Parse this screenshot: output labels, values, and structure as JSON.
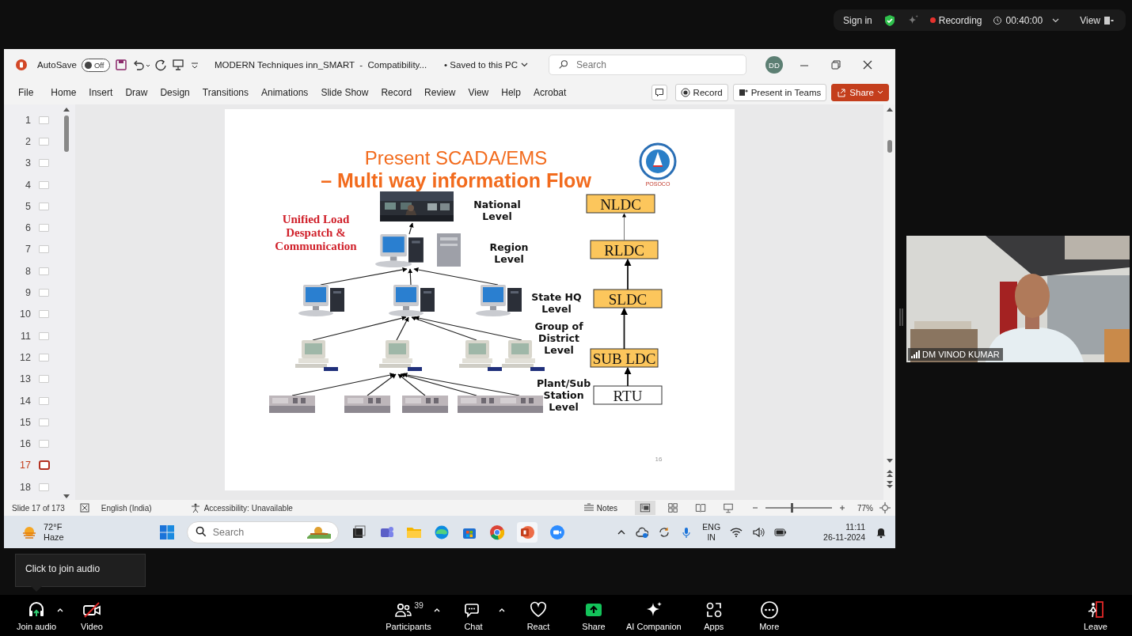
{
  "zoom_top_bar": {
    "sign_in": "Sign in",
    "recording": "Recording",
    "timer": "00:40:00",
    "view": "View"
  },
  "shared_screen": {
    "title_bar": {
      "autosave": "AutoSave",
      "autosave_on": false,
      "toggle_label": "Off",
      "document_title": "MODERN Techniques inn_SMART  -  Compatibility...",
      "save_status": "• Saved to this PC",
      "search_placeholder": "Search",
      "avatar": "DD"
    },
    "ribbon_tabs": [
      "File",
      "Home",
      "Insert",
      "Draw",
      "Design",
      "Transitions",
      "Animations",
      "Slide Show",
      "Record",
      "Review",
      "View",
      "Help",
      "Acrobat"
    ],
    "ribbon_buttons": [
      {
        "label": "Record",
        "kind": "record"
      },
      {
        "label": "Present in Teams",
        "kind": "teams"
      },
      {
        "label": "Share",
        "kind": "share"
      }
    ],
    "slide_thumbnails": [
      {
        "number": "1",
        "selected": false
      },
      {
        "number": "2",
        "selected": false
      },
      {
        "number": "3",
        "selected": false
      },
      {
        "number": "4",
        "selected": false
      },
      {
        "number": "5",
        "selected": false
      },
      {
        "number": "6",
        "selected": false
      },
      {
        "number": "7",
        "selected": false
      },
      {
        "number": "8",
        "selected": false
      },
      {
        "number": "9",
        "selected": false
      },
      {
        "number": "10",
        "selected": false
      },
      {
        "number": "11",
        "selected": false
      },
      {
        "number": "12",
        "selected": false
      },
      {
        "number": "13",
        "selected": false
      },
      {
        "number": "14",
        "selected": false
      },
      {
        "number": "15",
        "selected": false
      },
      {
        "number": "16",
        "selected": false
      },
      {
        "number": "17",
        "selected": true
      },
      {
        "number": "18",
        "selected": false
      }
    ],
    "slide": {
      "title_lines": [
        "Present SCADA/EMS",
        "– Multi way information Flow"
      ],
      "side_label": [
        "Unified Load",
        "Despatch &",
        "Communication"
      ],
      "levels": [
        {
          "lines": [
            "National",
            "Level"
          ]
        },
        {
          "lines": [
            "Region",
            "Level"
          ]
        },
        {
          "lines": [
            "State HQ",
            "Level"
          ]
        },
        {
          "lines": [
            "Group of",
            "District",
            "Level"
          ]
        },
        {
          "lines": [
            "Plant/Sub",
            "Station",
            "Level"
          ]
        }
      ],
      "hierarchy": [
        {
          "label": "NLDC",
          "highlighted": true
        },
        {
          "label": "RLDC",
          "highlighted": true
        },
        {
          "label": "SLDC",
          "highlighted": true
        },
        {
          "label": "SUB LDC",
          "highlighted": true
        },
        {
          "label": "RTU",
          "highlighted": false
        }
      ],
      "logo_text": "POSOCO",
      "page_number": "16"
    },
    "status_bar": {
      "slide_info": "Slide 17 of 173",
      "language": "English (India)",
      "accessibility": "Accessibility: Unavailable",
      "notes": "Notes",
      "view_buttons": [
        {
          "kind": "normal",
          "selected": true
        },
        {
          "kind": "sorter",
          "selected": false
        },
        {
          "kind": "reading",
          "selected": false
        },
        {
          "kind": "slideshow",
          "selected": false
        }
      ],
      "zoom": {
        "level": 0.38,
        "percent": "77%"
      }
    },
    "taskbar": {
      "temperature": "72°F",
      "weather": "Haze",
      "search_placeholder": "Search",
      "language": [
        "ENG",
        "IN"
      ],
      "time": "11:11",
      "date": "26-11-2024"
    }
  },
  "video_tile": {
    "name": "DM VINOD KUMAR"
  },
  "tooltip": "Click to join audio",
  "toolbar": [
    {
      "label": "Join audio",
      "kind": "audio",
      "caret": true
    },
    {
      "label": "Video",
      "kind": "video_off",
      "caret": false
    },
    {
      "label": "Participants",
      "kind": "participants",
      "count": "39",
      "caret": true
    },
    {
      "label": "Chat",
      "kind": "chat",
      "caret": true
    },
    {
      "label": "React",
      "kind": "react",
      "caret": false
    },
    {
      "label": "Share",
      "kind": "share",
      "caret": false
    },
    {
      "label": "AI Companion",
      "kind": "ai",
      "caret": false
    },
    {
      "label": "Apps",
      "kind": "apps",
      "caret": false
    },
    {
      "label": "More",
      "kind": "more",
      "caret": false
    },
    {
      "label": "Leave",
      "kind": "leave",
      "caret": false
    }
  ]
}
